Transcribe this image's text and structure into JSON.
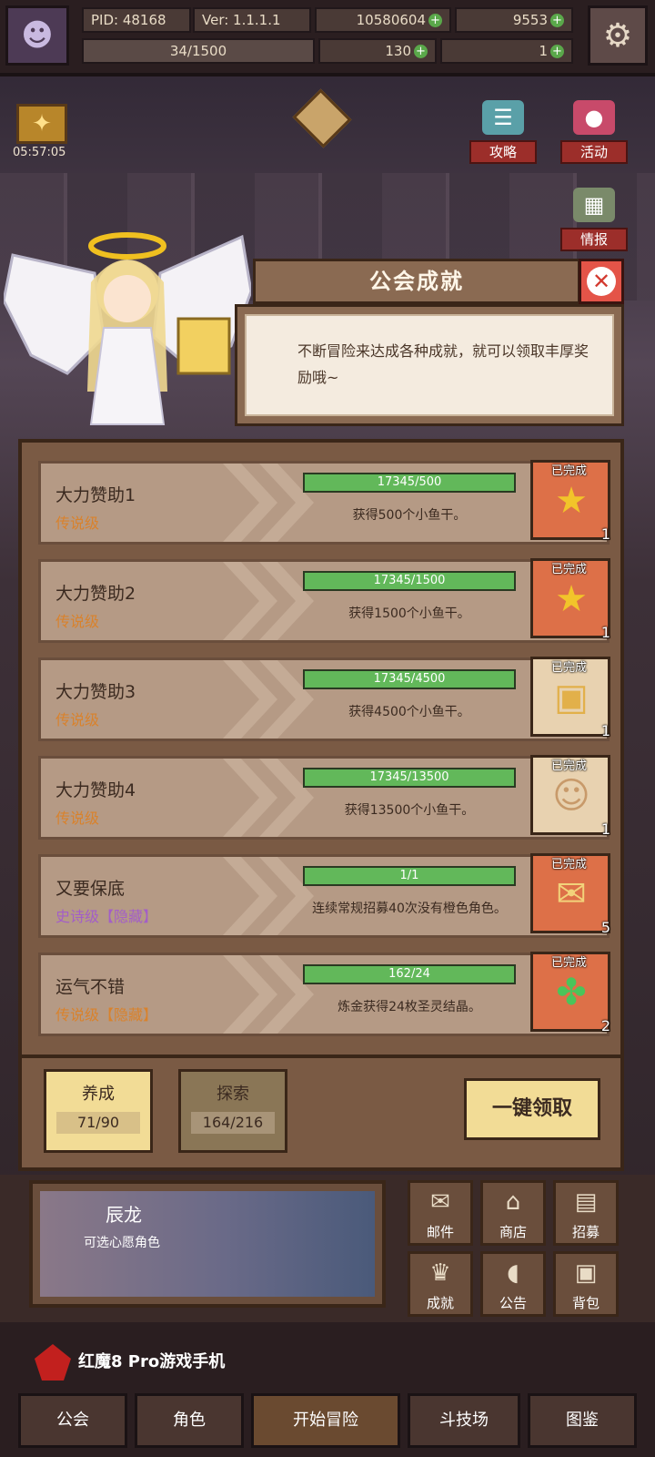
{
  "topbar": {
    "pid": "PID: 48168",
    "version": "Ver: 1.1.1.1",
    "gold": "10580604",
    "gems": "9553",
    "stamina": "34/1500",
    "clover": "130",
    "keys": "1"
  },
  "left_widget": {
    "timer": "05:57:05"
  },
  "side_buttons": {
    "guide": "攻略",
    "events": "活动",
    "intel": "情报"
  },
  "dialog": {
    "title": "公会成就",
    "description": "不断冒险来达成各种成就，就可以领取丰厚奖励哦~"
  },
  "achievements": [
    {
      "name": "大力赞助1",
      "rank": "传说级",
      "progress": "17345/500",
      "fraction": 1.0,
      "reward": "获得500个小鱼干。",
      "status": "已完成",
      "count": "1",
      "icon": "star-icon",
      "box_style": "red"
    },
    {
      "name": "大力赞助2",
      "rank": "传说级",
      "progress": "17345/1500",
      "fraction": 1.0,
      "reward": "获得1500个小鱼干。",
      "status": "已完成",
      "count": "1",
      "icon": "star-icon",
      "box_style": "red"
    },
    {
      "name": "大力赞助3",
      "rank": "传说级",
      "progress": "17345/4500",
      "fraction": 1.0,
      "reward": "获得4500个小鱼干。",
      "status": "已完成",
      "count": "1",
      "icon": "frame-icon",
      "box_style": "light"
    },
    {
      "name": "大力赞助4",
      "rank": "传说级",
      "progress": "17345/13500",
      "fraction": 1.0,
      "reward": "获得13500个小鱼干。",
      "status": "已完成",
      "count": "1",
      "icon": "portrait-icon",
      "box_style": "light"
    },
    {
      "name": "又要保底",
      "rank": "史诗级【隐藏】",
      "progress": "1/1",
      "fraction": 1.0,
      "reward": "连续常规招募40次没有橙色角色。",
      "status": "已完成",
      "count": "5",
      "icon": "envelope-icon",
      "box_style": "red"
    },
    {
      "name": "运气不错",
      "rank": "传说级【隐藏】",
      "progress": "162/24",
      "fraction": 1.0,
      "reward": "炼金获得24枚圣灵结晶。",
      "status": "已完成",
      "count": "2",
      "icon": "clover-icon",
      "box_style": "red"
    }
  ],
  "tabs": [
    {
      "label": "养成",
      "value": "71/90"
    },
    {
      "label": "探索",
      "value": "164/216"
    }
  ],
  "collect_all": "一键领取",
  "banner": {
    "name": "辰龙",
    "subtitle": "可选心愿角色"
  },
  "menu": {
    "mail": "邮件",
    "shop": "商店",
    "recruit": "招募",
    "achievement": "成就",
    "notice": "公告",
    "bag": "背包"
  },
  "navbar": {
    "guild": "公会",
    "character": "角色",
    "adventure": "开始冒险",
    "arena": "斗技场",
    "gallery": "图鉴"
  },
  "brand": "红魔8 Pro游戏手机"
}
